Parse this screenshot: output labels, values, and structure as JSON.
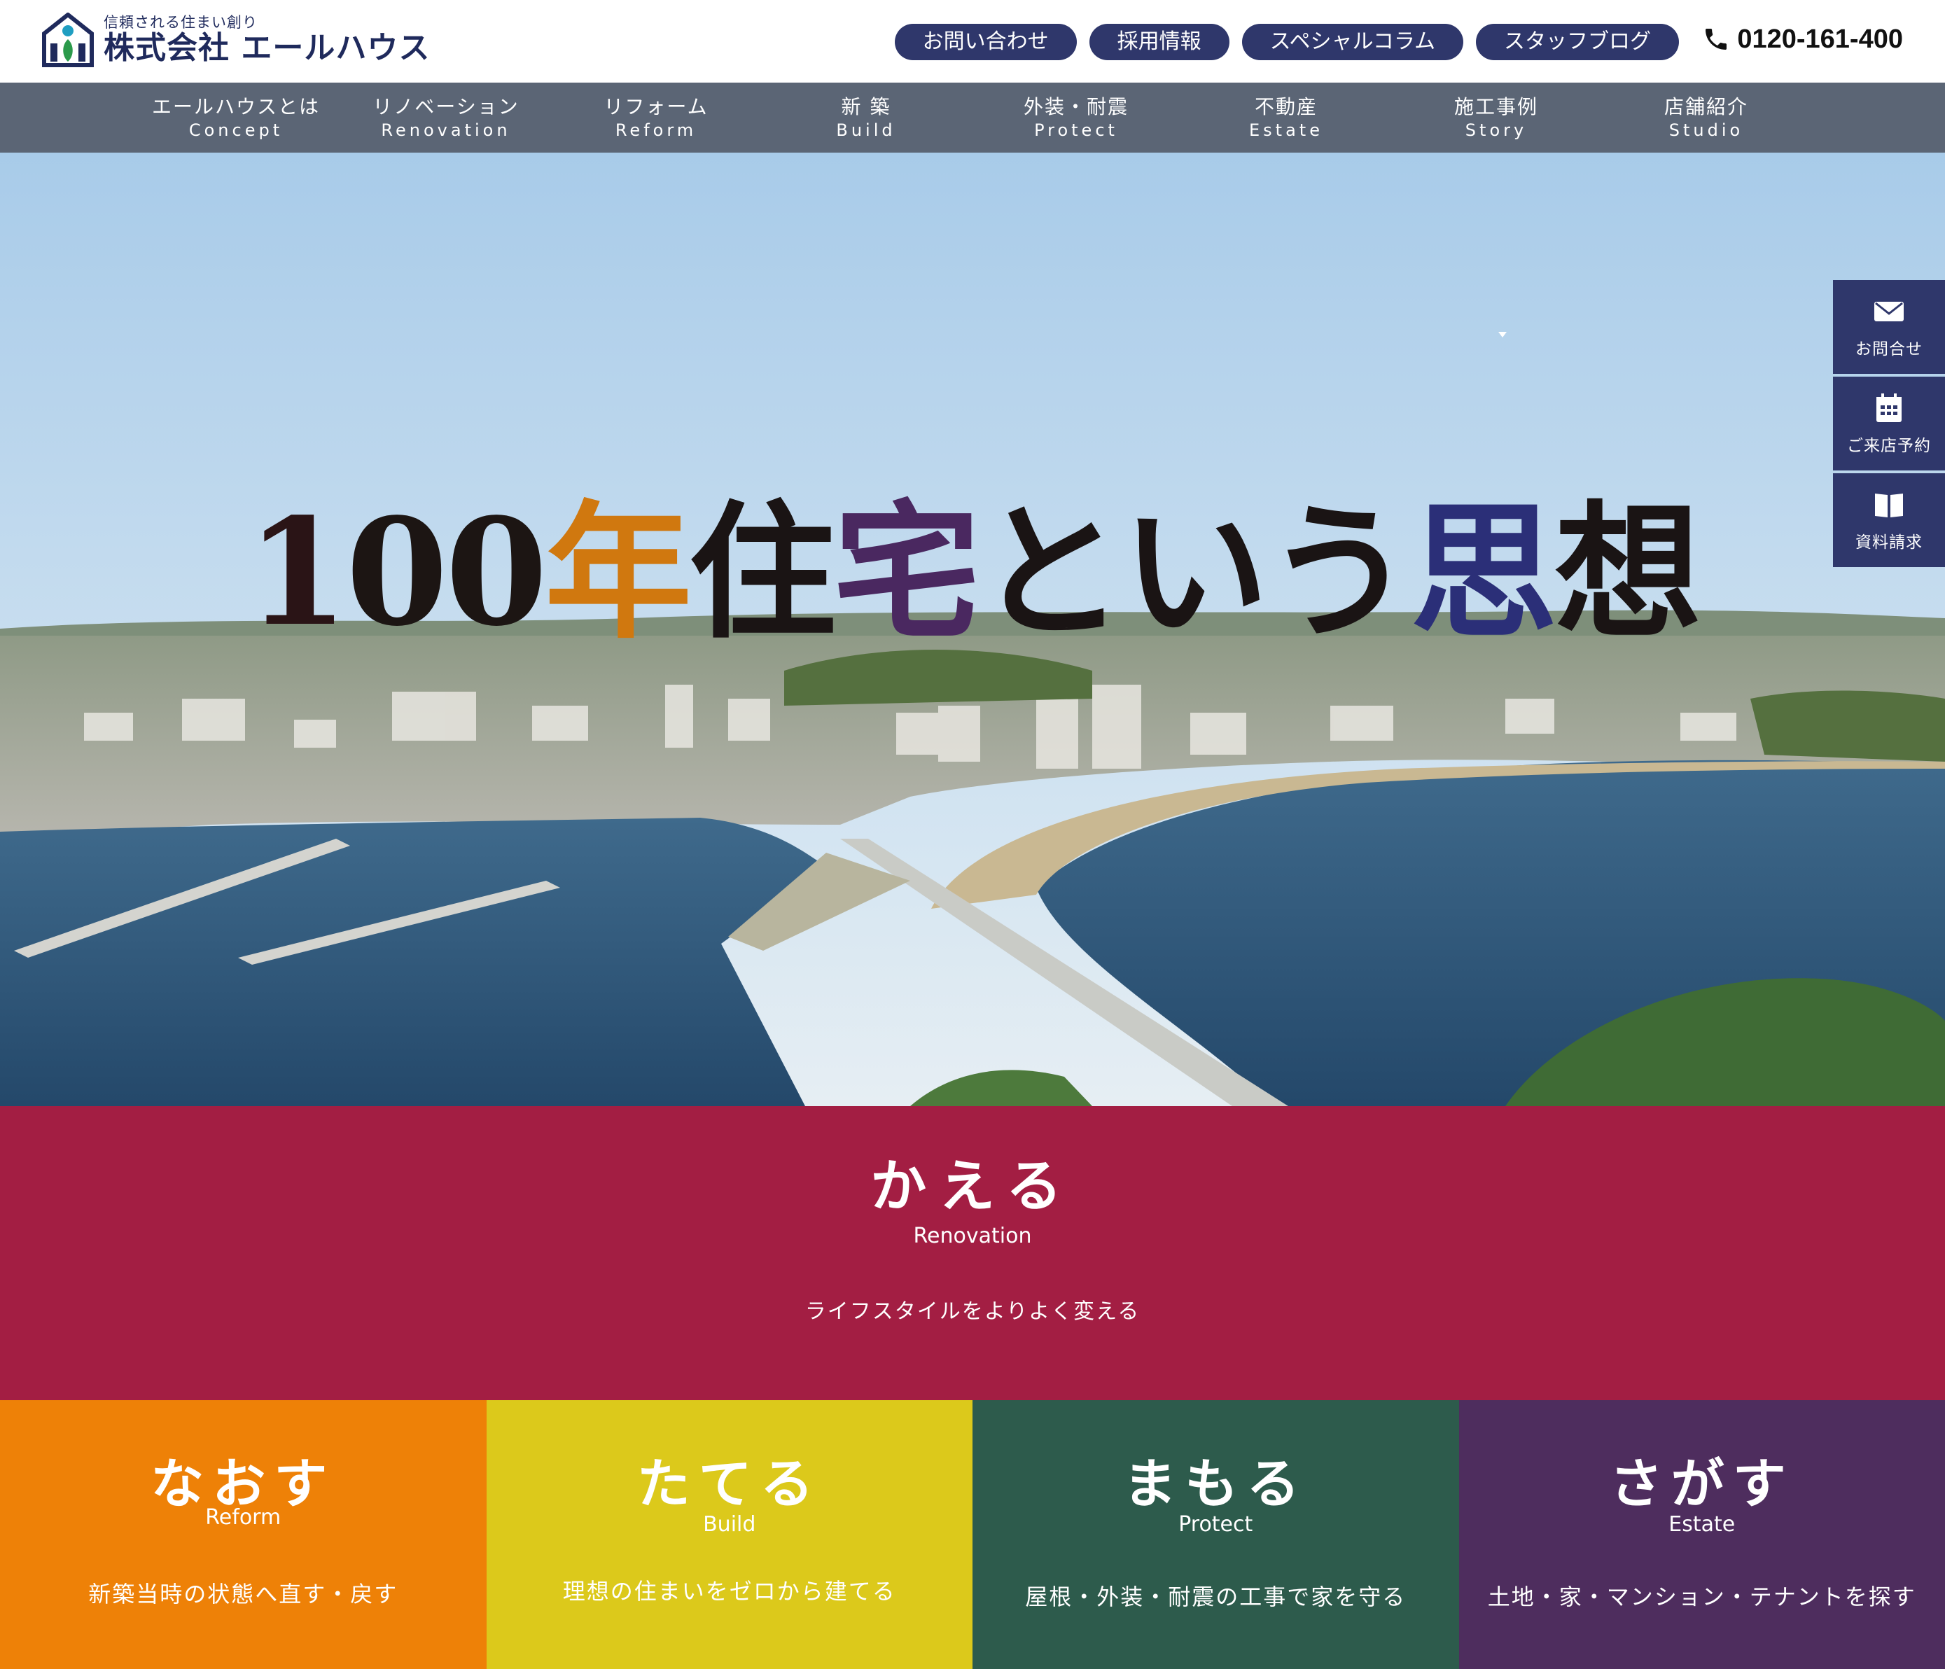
{
  "header": {
    "tagline": "信頼される住まい創り",
    "company": "株式会社 エールハウス",
    "links": [
      "お問い合わせ",
      "採用情報",
      "スペシャルコラム",
      "スタッフブログ"
    ],
    "phone": "0120-161-400"
  },
  "nav": [
    {
      "ja": "エールハウスとは",
      "en": "Concept"
    },
    {
      "ja": "リノベーション",
      "en": "Renovation"
    },
    {
      "ja": "リフォーム",
      "en": "Reform"
    },
    {
      "ja": "新 築",
      "en": "Build"
    },
    {
      "ja": "外装・耐震",
      "en": "Protect"
    },
    {
      "ja": "不動産",
      "en": "Estate"
    },
    {
      "ja": "施工事例",
      "en": "Story"
    },
    {
      "ja": "店舗紹介",
      "en": "Studio"
    }
  ],
  "hero": {
    "title_parts": [
      "1",
      "00",
      "年",
      "住",
      "宅",
      "という",
      "思",
      "想"
    ]
  },
  "side": [
    {
      "label": "お問合せ",
      "icon": "mail-icon"
    },
    {
      "label": "ご来店予約",
      "icon": "calendar-icon"
    },
    {
      "label": "資料請求",
      "icon": "book-icon"
    }
  ],
  "services": {
    "main": {
      "title": "かえる",
      "en": "Renovation",
      "desc": "ライフスタイルをよりよく変える",
      "color": "#a31e43"
    },
    "cards": [
      {
        "title": "なおす",
        "en": "Reform",
        "desc": "新築当時の状態へ直す・戻す",
        "color": "#ee8107"
      },
      {
        "title": "たてる",
        "en": "Build",
        "desc": "理想の住まいをゼロから建てる",
        "color": "#dcc91b"
      },
      {
        "title": "まもる",
        "en": "Protect",
        "desc": "屋根・外装・耐震の工事で家を守る",
        "color": "#2d5b4c"
      },
      {
        "title": "さがす",
        "en": "Estate",
        "desc": "土地・家・マンション・テナントを探す",
        "color": "#4e2d5e"
      }
    ]
  }
}
